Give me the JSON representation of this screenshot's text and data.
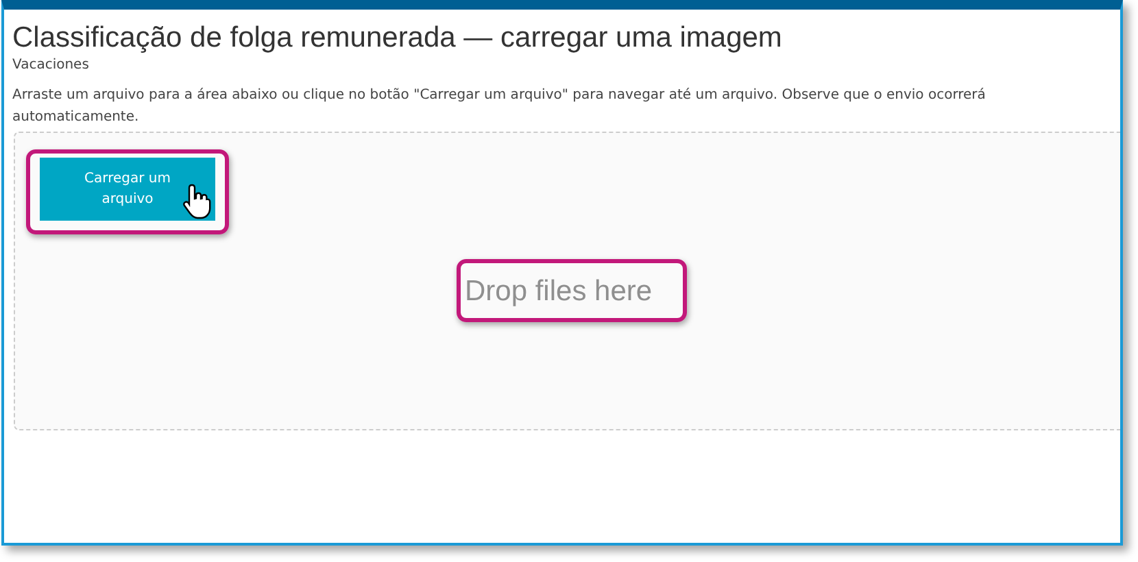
{
  "title": "Classificação de folga remunerada — carregar uma imagem",
  "subtitle": "Vacaciones",
  "instructions": "Arraste um arquivo para a área abaixo ou clique no botão \"Carregar um arquivo\" para navegar até um arquivo. Observe que o envio ocorrerá automaticamente.",
  "upload_button": {
    "label": "Carregar um arquivo",
    "highlighted": true,
    "hovered": true
  },
  "drop_zone": {
    "label": "Drop files here",
    "highlighted": true
  }
}
